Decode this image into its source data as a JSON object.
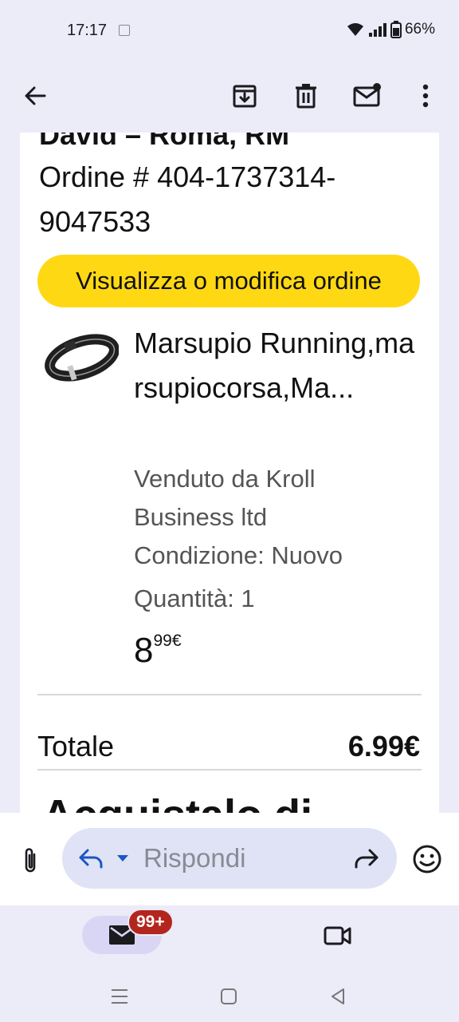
{
  "status_bar": {
    "time": "17:17",
    "battery": "66%"
  },
  "app_bar": {
    "icons": [
      "back-arrow-icon",
      "archive-icon",
      "delete-icon",
      "mark-unread-icon",
      "more-vert-icon"
    ]
  },
  "email": {
    "header_cut": "David – Roma, RM",
    "order_label": "Ordine # 404-1737314-9047533",
    "cta_label": "Visualizza o modifica ordine",
    "product": {
      "name": "Marsupio Running,marsupiocorsa,Ma...",
      "seller": "Venduto da Kroll Business ltd",
      "condition": "Condizione: Nuovo",
      "quantity": "Quantità: 1",
      "price_int": "8",
      "price_dec": "99€"
    },
    "total_label": "Totale",
    "total_value": "6.99€",
    "next_heading": "Acquistalo di"
  },
  "reply_bar": {
    "placeholder": "Rispondi"
  },
  "bottom_nav": {
    "mail_badge": "99+"
  },
  "colors": {
    "surface": "#ECEBF8",
    "cta": "#FFD814",
    "badge": "#B3261E",
    "reply_pill": "#DFE3F5",
    "reply_accent": "#1A56C4"
  }
}
